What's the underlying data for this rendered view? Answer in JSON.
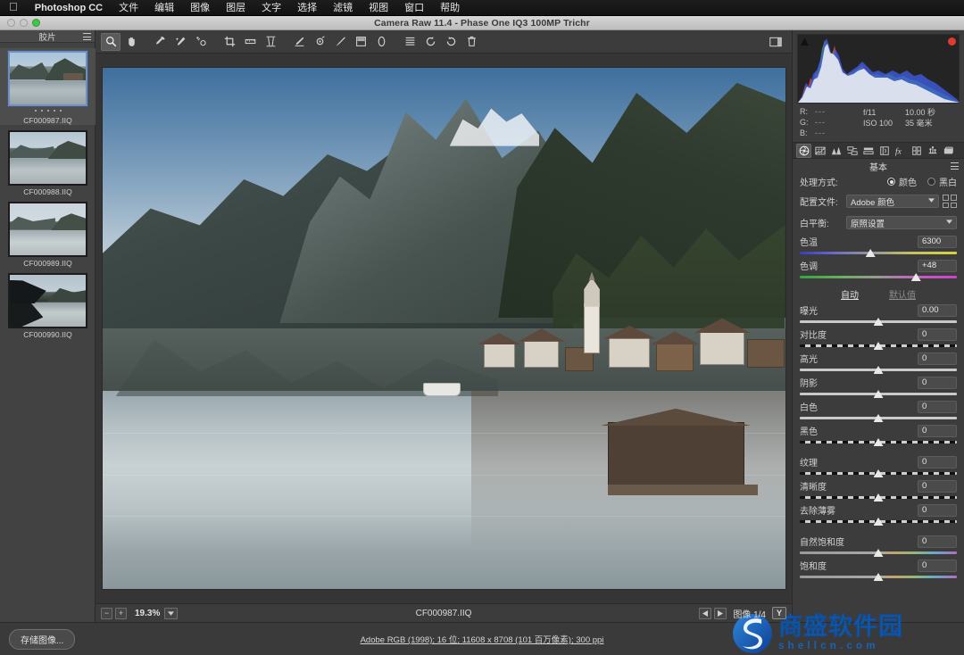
{
  "menubar": {
    "apple_icon": "apple-icon",
    "app_name": "Photoshop CC",
    "items": [
      "文件",
      "编辑",
      "图像",
      "图层",
      "文字",
      "选择",
      "滤镜",
      "视图",
      "窗口",
      "帮助"
    ]
  },
  "window": {
    "title": "Camera Raw 11.4 -  Phase One IQ3 100MP Trichr"
  },
  "filmstrip": {
    "title": "胶片",
    "menu_icon": "hamburger-icon",
    "items": [
      {
        "filename": "CF000987.IIQ",
        "selected": true,
        "rating_dots": 5,
        "scene": "sceneA"
      },
      {
        "filename": "CF000988.IIQ",
        "selected": false,
        "rating_dots": 0,
        "scene": "sceneB"
      },
      {
        "filename": "CF000989.IIQ",
        "selected": false,
        "rating_dots": 0,
        "scene": "sceneC"
      },
      {
        "filename": "CF000990.IIQ",
        "selected": false,
        "rating_dots": 0,
        "scene": "sceneD"
      }
    ]
  },
  "toolbar": {
    "tools": [
      {
        "name": "zoom-tool-icon",
        "active": true
      },
      {
        "name": "hand-tool-icon",
        "active": false
      },
      {
        "name": "white-balance-eyedropper-icon",
        "active": false
      },
      {
        "name": "color-sampler-icon",
        "active": false
      },
      {
        "name": "targeted-adjustment-icon",
        "active": false
      },
      {
        "name": "crop-tool-icon",
        "active": false
      },
      {
        "name": "straighten-tool-icon",
        "active": false
      },
      {
        "name": "transform-tool-icon",
        "active": false
      },
      {
        "name": "spot-removal-icon",
        "active": false
      },
      {
        "name": "red-eye-removal-icon",
        "active": false
      },
      {
        "name": "adjustment-brush-icon",
        "active": false
      },
      {
        "name": "graduated-filter-icon",
        "active": false
      },
      {
        "name": "radial-filter-icon",
        "active": false
      },
      {
        "name": "preferences-icon",
        "active": false
      },
      {
        "name": "rotate-left-icon",
        "active": false
      },
      {
        "name": "rotate-right-icon",
        "active": false
      },
      {
        "name": "delete-icon",
        "active": false
      },
      {
        "name": "fullscreen-toggle-icon",
        "active": false
      }
    ]
  },
  "statusbar": {
    "zoom_out_icon": "minus-box-icon",
    "zoom_in_icon": "plus-box-icon",
    "zoom_level": "19.3%",
    "zoom_caret_icon": "chevron-down-icon",
    "current_filename": "CF000987.IIQ",
    "prev_icon": "prev-arrow-icon",
    "next_icon": "next-arrow-icon",
    "image_counter": "图像 1/4",
    "preview_toggle_label": "Y"
  },
  "histogram": {
    "shadow_clip_icon": "shadow-clipping-icon",
    "highlight_clip_icon": "highlight-clipping-icon",
    "highlight_clip_color": "#e03c2e"
  },
  "readout": {
    "r_label": "R:",
    "g_label": "G:",
    "b_label": "B:",
    "r_value": "---",
    "g_value": "---",
    "b_value": "---",
    "aperture": "f/11",
    "shutter": "10.00 秒",
    "iso": "ISO 100",
    "focal_length": "35 毫米"
  },
  "panel_tabs": [
    {
      "name": "basic-panel-tab",
      "icon": "aperture-icon",
      "active": true
    },
    {
      "name": "tone-curve-tab",
      "icon": "curve-grid-icon",
      "active": false
    },
    {
      "name": "detail-tab",
      "icon": "triangles-icon",
      "active": false
    },
    {
      "name": "hsl-grayscale-tab",
      "icon": "hsl-icon",
      "active": false
    },
    {
      "name": "split-toning-tab",
      "icon": "split-toning-icon",
      "active": false
    },
    {
      "name": "lens-corrections-tab",
      "icon": "lens-icon",
      "active": false
    },
    {
      "name": "effects-tab",
      "icon": "fx-icon",
      "active": false
    },
    {
      "name": "calibration-tab",
      "icon": "calibration-icon",
      "active": false
    },
    {
      "name": "presets-tab",
      "icon": "presets-icon",
      "active": false
    },
    {
      "name": "snapshots-tab",
      "icon": "snapshots-icon",
      "active": false
    }
  ],
  "basic_panel": {
    "title": "基本",
    "menu_icon": "hamburger-icon",
    "treatment": {
      "label": "处理方式:",
      "options": [
        {
          "label": "颜色",
          "selected": true
        },
        {
          "label": "黑白",
          "selected": false
        }
      ]
    },
    "profile": {
      "label": "配置文件:",
      "value": "Adobe 颜色",
      "caret_icon": "chevron-down-icon",
      "browse_icon": "profile-grid-icon"
    },
    "white_balance": {
      "label": "白平衡:",
      "value": "原照设置",
      "caret_icon": "chevron-down-icon"
    },
    "auto_label": "自动",
    "default_label": "默认值",
    "sliders": [
      {
        "label": "色温",
        "value": "6300",
        "pos": 45,
        "track": "t-temp"
      },
      {
        "label": "色调",
        "value": "+48",
        "pos": 74,
        "track": "t-tint"
      },
      {
        "label": "曝光",
        "value": "0.00",
        "pos": 50,
        "track": "t-plain"
      },
      {
        "label": "对比度",
        "value": "0",
        "pos": 50,
        "track": "t-dash"
      },
      {
        "label": "高光",
        "value": "0",
        "pos": 50,
        "track": "t-plain"
      },
      {
        "label": "阴影",
        "value": "0",
        "pos": 50,
        "track": "t-plain"
      },
      {
        "label": "白色",
        "value": "0",
        "pos": 50,
        "track": "t-plain"
      },
      {
        "label": "黑色",
        "value": "0",
        "pos": 50,
        "track": "t-dash"
      },
      {
        "label": "纹理",
        "value": "0",
        "pos": 50,
        "track": "t-dash"
      },
      {
        "label": "清晰度",
        "value": "0",
        "pos": 50,
        "track": "t-dash"
      },
      {
        "label": "去除薄雾",
        "value": "0",
        "pos": 50,
        "track": "t-dash"
      },
      {
        "label": "自然饱和度",
        "value": "0",
        "pos": 50,
        "track": "t-vib"
      },
      {
        "label": "饱和度",
        "value": "0",
        "pos": 50,
        "track": "t-vib"
      }
    ]
  },
  "bottombar": {
    "save_image_label": "存储图像...",
    "info_link": "Adobe RGB (1998); 16 位;  11608 x 8708 (101 百万像素);  300 ppi"
  },
  "watermark": {
    "logo_icon": "shellcn-s-logo-icon",
    "chinese_name": "商盛软件园",
    "domain": "shellcn.com",
    "brand_color": "#1763b8"
  }
}
